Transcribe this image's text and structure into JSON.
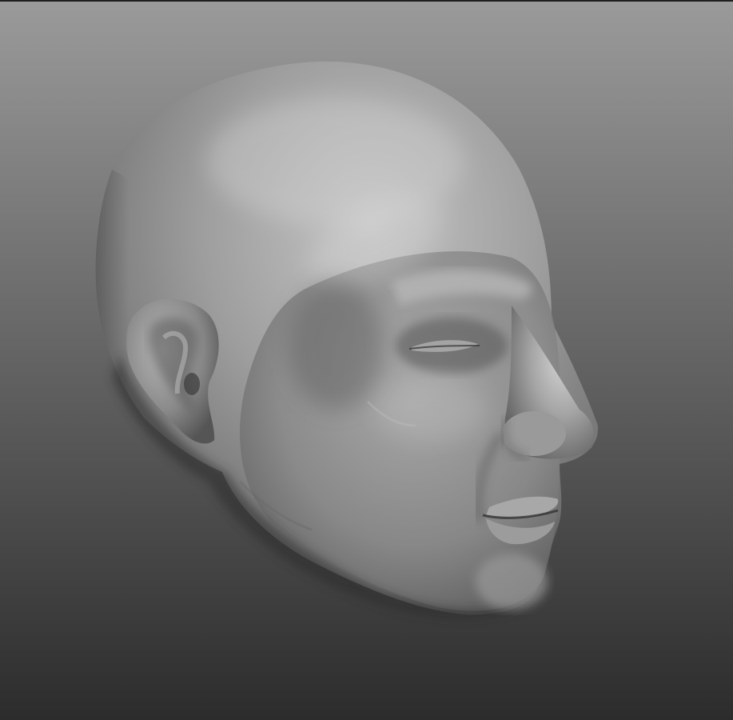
{
  "viewport": {
    "background_top": "#9a9a9a",
    "background_bottom": "#2c2c2c",
    "model_base": "#8c8c8c",
    "model_highlight": "#d2d2d2",
    "model_shadow": "#3a3a3a"
  },
  "model": {
    "icon": "sculpted-head-model"
  }
}
